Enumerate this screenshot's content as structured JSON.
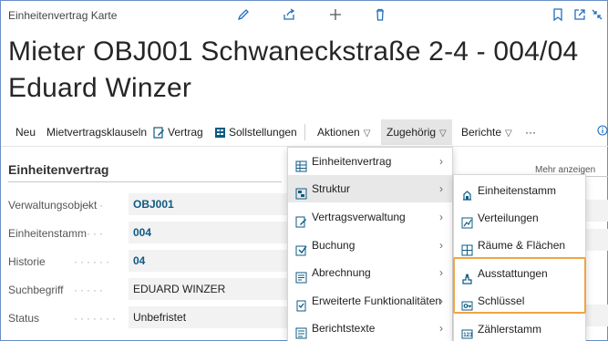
{
  "header": {
    "page_type": "Einheitenvertrag Karte",
    "icons": [
      "edit-icon",
      "share-icon",
      "new-icon",
      "delete-icon",
      "bookmark-icon",
      "open-new-window-icon",
      "collapse-icon"
    ]
  },
  "title": {
    "line1": "Mieter OBJ001 Schwaneckstraße 2-4 - 004/04",
    "line2": "Eduard Winzer"
  },
  "actions": {
    "neu": "Neu",
    "mietvertragsklauseln": "Mietvertragsklauseln",
    "vertrag": "Vertrag",
    "sollstellungen": "Sollstellungen",
    "aktionen": "Aktionen",
    "zugehoerig": "Zugehörig",
    "berichte": "Berichte",
    "more": "···"
  },
  "section": {
    "title": "Einheitenvertrag",
    "show_more": "Mehr anzeigen"
  },
  "fields": [
    {
      "label": "Verwaltungsobjekt",
      "value": "OBJ001",
      "link": true
    },
    {
      "label": "Einheitenstamm",
      "value": "004",
      "link": true
    },
    {
      "label": "Historie",
      "value": "04",
      "link": true
    },
    {
      "label": "Suchbegriff",
      "value": "EDUARD WINZER",
      "link": false
    },
    {
      "label": "Status",
      "value": "Unbefristet",
      "link": false
    }
  ],
  "menu_level1": [
    {
      "label": "Einheitenvertrag",
      "icon": "grid-icon"
    },
    {
      "label": "Struktur",
      "icon": "structure-icon"
    },
    {
      "label": "Vertragsverwaltung",
      "icon": "contract-icon"
    },
    {
      "label": "Buchung",
      "icon": "booking-icon"
    },
    {
      "label": "Abrechnung",
      "icon": "billing-icon"
    },
    {
      "label": "Erweiterte Funktionalitäten",
      "icon": "checklist-icon"
    },
    {
      "label": "Berichtstexte",
      "icon": "report-text-icon"
    }
  ],
  "menu_level2": [
    {
      "label": "Einheitenstamm",
      "icon": "unit-icon"
    },
    {
      "label": "Verteilungen",
      "icon": "distribution-icon"
    },
    {
      "label": "Räume & Flächen",
      "icon": "rooms-icon"
    },
    {
      "label": "Ausstattungen",
      "icon": "equipment-icon"
    },
    {
      "label": "Schlüssel",
      "icon": "key-icon"
    },
    {
      "label": "Zählerstamm",
      "icon": "meter-icon"
    }
  ],
  "colors": {
    "accent": "#1f6fbf",
    "link": "#0d5b83",
    "highlight": "#f0a544"
  }
}
